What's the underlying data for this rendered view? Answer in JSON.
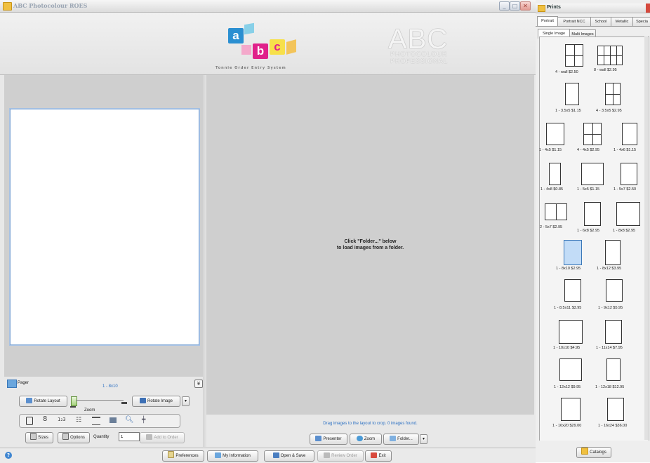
{
  "window": {
    "title": "ABC Photocolour ROES",
    "min": "_",
    "max": "□",
    "close": "✕"
  },
  "banner": {
    "cube_letters": [
      "a",
      "b",
      "c"
    ],
    "tagline": "Tonnie Order Entry System",
    "logo_big": "ABC",
    "logo_sub1": "PHOTOCOLOUR",
    "logo_sub2": "PROFESSIONAL"
  },
  "center": {
    "hint_line1": "Click \"Folder...\" below",
    "hint_line2": "to load images from a folder.",
    "status": "Drag images to the layout to crop. 0 images found.",
    "buttons": {
      "presenter": "Presenter",
      "zoom": "Zoom",
      "folder": "Folder..."
    }
  },
  "pager": {
    "label": "Pager",
    "current": "1 - 8x10",
    "rotate_layout": "Rotate Layout",
    "zoom_label": "Zoom",
    "rotate_image": "Rotate Image",
    "sizes": "Sizes",
    "options": "Options",
    "quantity_label": "Quantity",
    "quantity_value": "1",
    "add_to_order": "Add to Order",
    "tool_icons": [
      "move-icon",
      "stack-icon",
      "number-icon",
      "grid-icon",
      "flip-h-icon",
      "flip-v-icon",
      "search-icon",
      "center-icon"
    ]
  },
  "bottombar": {
    "preferences": "Preferences",
    "my_information": "My Information",
    "open_save": "Open & Save",
    "review_order": "Review Order",
    "exit": "Exit"
  },
  "prints": {
    "title": "Prints",
    "tabs": [
      "Portrait",
      "Portrait NCC",
      "School",
      "Metallic",
      "Specia"
    ],
    "subtabs": [
      "Single Image",
      "Multi Images"
    ],
    "items": [
      "4 - wall $2.50",
      "8 - wall $2.95",
      "1 - 3.5x5 $1.15",
      "4 - 3.5x5 $2.95",
      "1 - 4x5 $1.15",
      "4 - 4x5 $2.95",
      "1 - 4x6 $1.15",
      "1 - 4x8 $0.85",
      "1 - 5x5 $1.15",
      "1 - 5x7 $2.50",
      "2 - 5x7 $2.95",
      "1 - 6x8 $2.95",
      "1 - 8x8 $2.95",
      "1 - 8x10 $2.95",
      "1 - 8x12 $3.95",
      "1 - 8.5x11 $3.95",
      "1 - 9x12 $5.95",
      "1 - 10x10 $4.95",
      "1 - 11x14 $7.95",
      "1 - 12x12 $9.95",
      "1 - 12x18 $12.95",
      "1 - 16x20 $29.00",
      "1 - 16x24 $36.00"
    ],
    "selected": "1 - 8x10 $2.95",
    "catalogs": "Catalogs"
  },
  "colors": {
    "accent_blue": "#3a77b8",
    "selection": "#c2dcf7",
    "panel_gray": "#cfcfcf"
  }
}
